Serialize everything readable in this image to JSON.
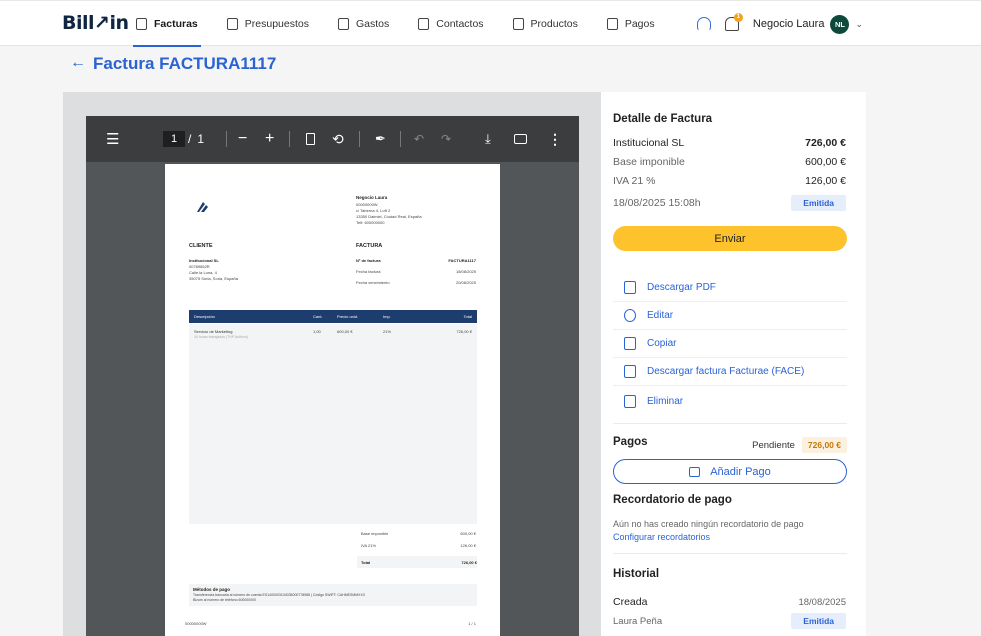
{
  "brand": {
    "logo": "Bill↗in"
  },
  "nav": {
    "items": [
      {
        "label": "Facturas",
        "icon": "invoice-icon",
        "active": true
      },
      {
        "label": "Presupuestos",
        "icon": "quote-icon"
      },
      {
        "label": "Gastos",
        "icon": "expense-icon"
      },
      {
        "label": "Contactos",
        "icon": "contacts-icon"
      },
      {
        "label": "Productos",
        "icon": "products-icon"
      },
      {
        "label": "Pagos",
        "icon": "payments-icon"
      }
    ],
    "notifications_count": "1",
    "user_name": "Negocio Laura",
    "user_initials": "NL"
  },
  "page": {
    "title": "Factura FACTURA1117"
  },
  "pdf_viewer": {
    "page_current": "1",
    "page_separator": "/",
    "page_total": "1",
    "document": {
      "company_name": "Negocio Laura",
      "company_lines": [
        "00000000W",
        "c/ Taberna 4, Loft 2",
        "13350 Daimiel, Ciudad Real, España",
        "Telf: 600000000"
      ],
      "client_heading": "CLIENTE",
      "client_name": "Institucional SL",
      "client_lines": [
        "00789852R",
        "Calle la Luna, 4",
        "35075 Soria, Soria, España"
      ],
      "invoice_heading": "FACTURA",
      "invoice_number_label": "Nº de factura",
      "invoice_number": "FACTURA1117",
      "invoice_date_label": "Fecha factura",
      "invoice_date": "18/08/2025",
      "due_date_label": "Fecha vencimiento",
      "due_date": "20/08/2025",
      "table_headers": [
        "Descripción",
        "Cant.",
        "Precio unid.",
        "Imp.",
        "Total"
      ],
      "line_item": {
        "description": "Servicio de Marketing",
        "detail": "40 horas trabajadas (THP Ashford)",
        "qty": "1,00",
        "unit_price": "600,00 €",
        "tax": "21%",
        "total": "726,00 €"
      },
      "base_label": "Base imponible",
      "base_value": "600,00 €",
      "iva_label": "IVA 21%",
      "iva_value": "126,00 €",
      "total_label": "Total",
      "total_value": "726,00 €",
      "payment_heading": "Métodos de pago",
      "payment_line1": "Transferencia bancaria al número de cuenta ES1400003104035000778988 | Código SWIFT: CAHMESMMXXX",
      "payment_line2": "Bizum al número de teléfono 600000000",
      "footer_left": "00000000W",
      "footer_right": "1 / 1"
    }
  },
  "detail": {
    "title": "Detalle de Factura",
    "client": "Institucional SL",
    "total": "726,00 €",
    "base_label": "Base imponible",
    "base_value": "600,00 €",
    "iva_label": "IVA 21 %",
    "iva_value": "126,00 €",
    "datetime": "18/08/2025 15:08h",
    "status": "Emitida",
    "send_label": "Enviar"
  },
  "actions": [
    {
      "label": "Descargar PDF",
      "icon": "pdf-file-icon"
    },
    {
      "label": "Editar",
      "icon": "edit-icon"
    },
    {
      "label": "Copiar",
      "icon": "copy-icon"
    },
    {
      "label": "Descargar factura Facturae (FACE)",
      "icon": "facturae-file-icon"
    },
    {
      "label": "Eliminar",
      "icon": "trash-icon"
    }
  ],
  "payments": {
    "title": "Pagos",
    "status": "Pendiente",
    "amount": "726,00 €",
    "add_label": "Añadir Pago"
  },
  "reminder": {
    "title": "Recordatorio de pago",
    "empty_text": "Aún no has creado ningún recordatorio de pago",
    "configure_link": "Configurar recordatorios"
  },
  "history": {
    "title": "Historial",
    "event": "Creada",
    "date": "18/08/2025",
    "user": "Laura Peña",
    "status": "Emitida"
  },
  "colors": {
    "accent": "#2a63d4",
    "send": "#fec32c",
    "brand_dark": "#102542"
  }
}
